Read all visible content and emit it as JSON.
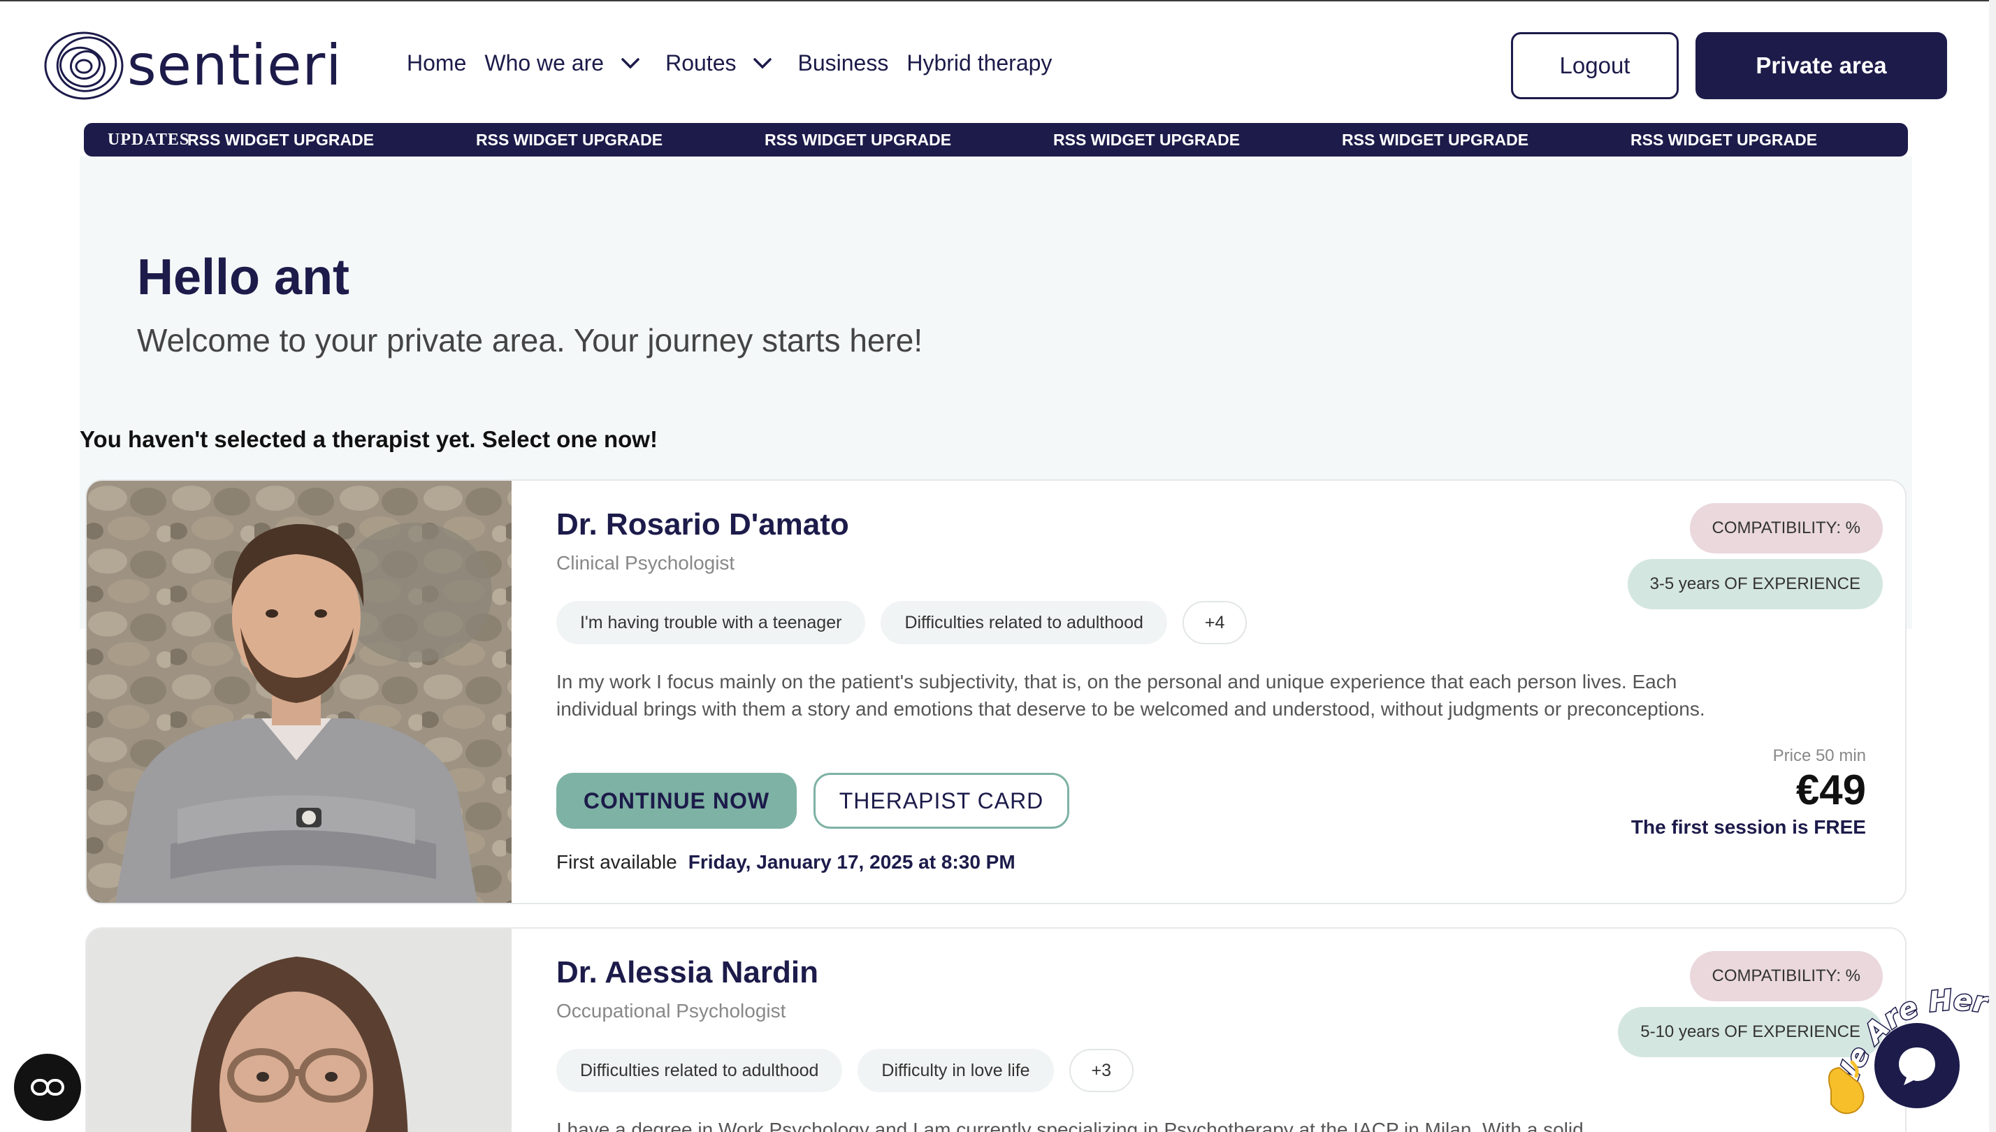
{
  "header": {
    "logo_text": "sentieri",
    "nav": [
      {
        "label": "Home",
        "has_dropdown": false
      },
      {
        "label": "Who we are",
        "has_dropdown": true
      },
      {
        "label": "Routes",
        "has_dropdown": true
      },
      {
        "label": "Business",
        "has_dropdown": false
      },
      {
        "label": "Hybrid therapy",
        "has_dropdown": false
      }
    ],
    "logout_label": "Logout",
    "private_area_label": "Private area"
  },
  "ticker": {
    "label": "UPDATES",
    "items": [
      "RSS WIDGET UPGRADE",
      "RSS WIDGET UPGRADE",
      "RSS WIDGET UPGRADE",
      "RSS WIDGET UPGRADE",
      "RSS WIDGET UPGRADE",
      "RSS WIDGET UPGRADE"
    ]
  },
  "hero": {
    "title": "Hello ant",
    "subtitle": "Welcome to your private area. Your journey starts here!"
  },
  "select_message": "You haven't selected a therapist yet. Select one now!",
  "therapists": [
    {
      "name": "Dr. Rosario D'amato",
      "role": "Clinical Psychologist",
      "tags": [
        "I'm having trouble with a teenager",
        "Difficulties related to adulthood"
      ],
      "more_tags": "+4",
      "description": "In my work I focus mainly on the patient's subjectivity, that is, on the personal and unique experience that each person lives. Each individual brings with them a story and emotions that deserve to be welcomed and understood, without judgments or preconceptions.",
      "compatibility": "COMPATIBILITY: %",
      "experience": "3-5 years OF EXPERIENCE",
      "continue_label": "CONTINUE NOW",
      "card_label": "THERAPIST CARD",
      "first_available_label": "First available",
      "first_available_value": "Friday, January 17, 2025 at 8:30 PM",
      "price_label": "Price 50 min",
      "price": "€49",
      "free_note": "The first session is FREE"
    },
    {
      "name": "Dr. Alessia Nardin",
      "role": "Occupational Psychologist",
      "tags": [
        "Difficulties related to adulthood",
        "Difficulty in love life"
      ],
      "more_tags": "+3",
      "description": "I have a degree in Work Psychology and I am currently specializing in Psychotherapy at the IACP in Milan. With a solid",
      "compatibility": "COMPATIBILITY: %",
      "experience": "5-10 years OF EXPERIENCE"
    }
  ],
  "widgets": {
    "we_are_here": "We Are Here!",
    "accessibility_icon": "accessibility-icon",
    "chat_icon": "chat-icon"
  },
  "colors": {
    "brand_navy": "#1c1b4a",
    "accent_teal": "#7eb2a4",
    "compat_pink": "#ead8dd",
    "experience_green": "#d4e6e0"
  }
}
